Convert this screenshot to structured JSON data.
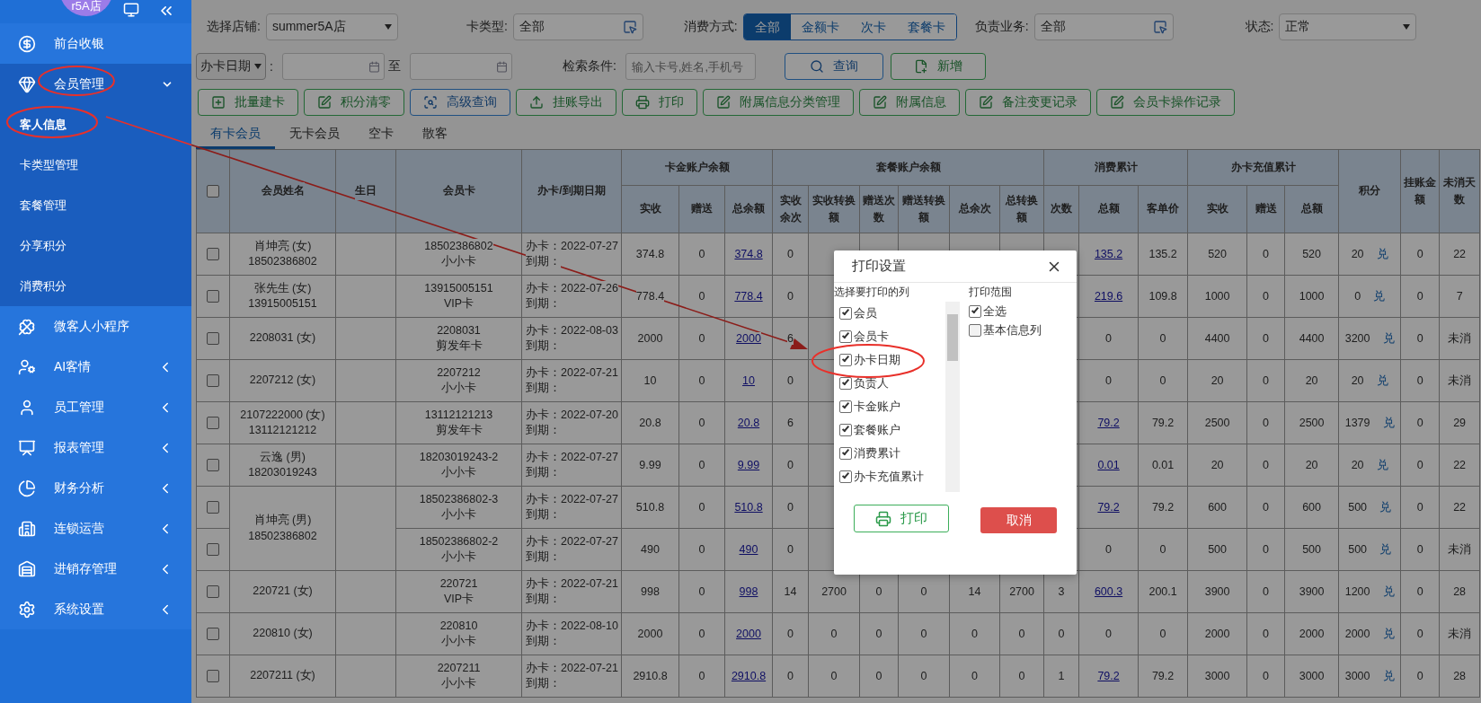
{
  "sidebar": {
    "store_badge": "r5A店",
    "items": [
      {
        "label": "前台收银"
      },
      {
        "label": "会员管理",
        "expanded": true,
        "children": [
          {
            "label": "客人信息",
            "selected": true
          },
          {
            "label": "卡类型管理",
            "selected": false
          },
          {
            "label": "套餐管理",
            "selected": false
          },
          {
            "label": "分享积分",
            "selected": false
          },
          {
            "label": "消费积分",
            "selected": false
          }
        ]
      },
      {
        "label": "微客人小程序"
      },
      {
        "label": "AI客情",
        "expanded": false
      },
      {
        "label": "员工管理",
        "expanded": false
      },
      {
        "label": "报表管理",
        "expanded": false
      },
      {
        "label": "财务分析",
        "expanded": false
      },
      {
        "label": "连锁运营",
        "expanded": false
      },
      {
        "label": "进销存管理",
        "expanded": false
      },
      {
        "label": "系统设置",
        "expanded": false
      }
    ]
  },
  "filters": {
    "store": {
      "label": "选择店铺:",
      "value": "summer5A店"
    },
    "card_type": {
      "label": "卡类型:",
      "value": "全部"
    },
    "consume_mode": {
      "label": "消费方式:",
      "options": [
        {
          "label": "全部",
          "selected": true
        },
        {
          "label": "金额卡",
          "selected": false
        },
        {
          "label": "次卡",
          "selected": false
        },
        {
          "label": "套餐卡",
          "selected": false
        }
      ]
    },
    "staff": {
      "label": "负责业务:",
      "value": "全部"
    },
    "status": {
      "label": "状态:",
      "value": "正常"
    },
    "date_type": "办卡日期",
    "date_separator": ":",
    "date_to": "至",
    "search": {
      "label": "检索条件:",
      "placeholder": "输入卡号,姓名,手机号"
    },
    "query_button": "查询",
    "add_button": "新增"
  },
  "actions": [
    {
      "label": "批量建卡",
      "kind": "success"
    },
    {
      "label": "积分清零",
      "kind": "success"
    },
    {
      "label": "高级查询",
      "kind": "info"
    },
    {
      "label": "挂账导出",
      "kind": "success"
    },
    {
      "label": "打印",
      "kind": "success"
    },
    {
      "label": "附属信息分类管理",
      "kind": "success"
    },
    {
      "label": "附属信息",
      "kind": "success"
    },
    {
      "label": "备注变更记录",
      "kind": "success"
    },
    {
      "label": "会员卡操作记录",
      "kind": "success"
    }
  ],
  "tabs": [
    {
      "label": "有卡会员",
      "selected": true
    },
    {
      "label": "无卡会员",
      "selected": false
    },
    {
      "label": "空卡",
      "selected": false
    },
    {
      "label": "散客",
      "selected": false
    }
  ],
  "table": {
    "select_all_checked": false,
    "columns": [
      {
        "label": "会员姓名"
      },
      {
        "label": "生日"
      },
      {
        "label": "会员卡"
      },
      {
        "label": "办卡/到期日期"
      },
      {
        "label": "卡金账户余额",
        "children": [
          "实收",
          "赠送",
          "总余额"
        ]
      },
      {
        "label": "套餐账户余额",
        "children": [
          "实收余次",
          "实收转换额",
          "赠送次数",
          "赠送转换额",
          "总余次",
          "总转换额"
        ]
      },
      {
        "label": "消费累计",
        "children": [
          "次数",
          "总额",
          "客单价"
        ]
      },
      {
        "label": "办卡充值累计",
        "children": [
          "实收",
          "赠送",
          "总额"
        ]
      },
      {
        "label": "积分"
      },
      {
        "label": "挂账金额"
      },
      {
        "label": "未消天数"
      }
    ],
    "members": [
      {
        "name": "肖坤亮 (女)",
        "phone": "18502386802",
        "cards": [
          {
            "number": "18502386802",
            "type": "小小卡",
            "open": "办卡：2022-07-27",
            "expire": "到期：",
            "checked": false,
            "cells": [
              "374.8",
              "0",
              {
                "link": "374.8"
              },
              "0",
              null,
              null,
              null,
              null,
              null,
              null,
              {
                "link": "135.2"
              },
              "135.2",
              "520",
              "0",
              "520",
              {
                "text": "20",
                "action": "兑"
              },
              "0",
              "22"
            ]
          }
        ]
      },
      {
        "name": "张先生 (女)",
        "phone": "13915005151",
        "cards": [
          {
            "number": "13915005151",
            "type": "VIP卡",
            "open": "办卡：2022-07-26",
            "expire": "到期：",
            "checked": false,
            "cells": [
              "778.4",
              "0",
              {
                "link": "778.4"
              },
              "0",
              null,
              null,
              null,
              null,
              null,
              null,
              {
                "link": "219.6"
              },
              "109.8",
              "1000",
              "0",
              "1000",
              {
                "text": "0",
                "action": "兑"
              },
              "0",
              "7"
            ]
          }
        ]
      },
      {
        "name": "2208031 (女)",
        "cards": [
          {
            "number": "2208031",
            "type": "剪发年卡",
            "open": "办卡：2022-08-03",
            "expire": "到期：",
            "checked": false,
            "cells": [
              "2000",
              "0",
              {
                "link": "2000"
              },
              "6",
              null,
              null,
              null,
              null,
              null,
              null,
              "0",
              "0",
              "4400",
              "0",
              "4400",
              {
                "text": "3200",
                "action": "兑"
              },
              "0",
              "未消"
            ]
          }
        ]
      },
      {
        "name": "2207212 (女)",
        "cards": [
          {
            "number": "2207212",
            "type": "小小卡",
            "open": "办卡：2022-07-21",
            "expire": "到期：",
            "checked": false,
            "cells": [
              "10",
              "0",
              {
                "link": "10"
              },
              "0",
              null,
              null,
              null,
              null,
              null,
              null,
              "0",
              "0",
              "20",
              "0",
              "20",
              {
                "text": "20",
                "action": "兑"
              },
              "0",
              "未消"
            ]
          }
        ]
      },
      {
        "name": "2107222000 (女)",
        "phone": "13112121212",
        "cards": [
          {
            "number": "13112121213",
            "type": "剪发年卡",
            "open": "办卡：2022-07-20",
            "expire": "到期：",
            "checked": false,
            "cells": [
              "20.8",
              "0",
              {
                "link": "20.8"
              },
              "6",
              null,
              null,
              null,
              null,
              null,
              null,
              {
                "link": "79.2"
              },
              "79.2",
              "2500",
              "0",
              "2500",
              {
                "text": "1379",
                "action": "兑"
              },
              "0",
              "29"
            ]
          }
        ]
      },
      {
        "name": "云逸 (男)",
        "phone": "18203019243",
        "cards": [
          {
            "number": "18203019243-2",
            "type": "小小卡",
            "open": "办卡：2022-07-27",
            "expire": "到期：",
            "checked": false,
            "cells": [
              "9.99",
              "0",
              {
                "link": "9.99"
              },
              "0",
              null,
              null,
              null,
              null,
              null,
              null,
              {
                "link": "0.01"
              },
              "0.01",
              "20",
              "0",
              "20",
              {
                "text": "20",
                "action": "兑"
              },
              "0",
              "22"
            ]
          }
        ]
      },
      {
        "name": "肖坤亮 (男)",
        "phone": "18502386802",
        "cards": [
          {
            "number": "18502386802-3",
            "type": "小小卡",
            "open": "办卡：2022-07-27",
            "expire": "到期：",
            "checked": false,
            "cells": [
              "510.8",
              "0",
              {
                "link": "510.8"
              },
              "0",
              null,
              null,
              null,
              null,
              null,
              null,
              {
                "link": "79.2"
              },
              "79.2",
              "600",
              "0",
              "600",
              {
                "text": "500",
                "action": "兑"
              },
              "0",
              "22"
            ]
          },
          {
            "number": "18502386802-2",
            "type": "小小卡",
            "open": "办卡：2022-07-27",
            "expire": "到期：",
            "checked": false,
            "cells": [
              "490",
              "0",
              {
                "link": "490"
              },
              "0",
              null,
              null,
              null,
              null,
              null,
              null,
              "0",
              "0",
              "500",
              "0",
              "500",
              {
                "text": "500",
                "action": "兑"
              },
              "0",
              "未消"
            ]
          }
        ]
      },
      {
        "name": "220721 (女)",
        "cards": [
          {
            "number": "220721",
            "type": "VIP卡",
            "open": "办卡：2022-07-21",
            "expire": "到期：",
            "checked": false,
            "cells": [
              "998",
              "0",
              {
                "link": "998"
              },
              "14",
              "2700",
              "0",
              "0",
              "14",
              "2700",
              "3",
              {
                "link": "600.3"
              },
              "200.1",
              "3900",
              "0",
              "3900",
              {
                "text": "1200",
                "action": "兑"
              },
              "0",
              "28"
            ]
          }
        ]
      },
      {
        "name": "220810 (女)",
        "cards": [
          {
            "number": "220810",
            "type": "小小卡",
            "open": "办卡：2022-08-10",
            "expire": "到期：",
            "checked": false,
            "cells": [
              "2000",
              "0",
              {
                "link": "2000"
              },
              "0",
              "0",
              "0",
              "0",
              "0",
              "0",
              "0",
              "0",
              "0",
              "2000",
              "0",
              "2000",
              {
                "text": "2000",
                "action": "兑"
              },
              "0",
              "未消"
            ]
          }
        ]
      },
      {
        "name": "2207211 (女)",
        "cards": [
          {
            "number": "2207211",
            "type": "小小卡",
            "open": "办卡：2022-07-21",
            "expire": "到期：",
            "checked": false,
            "cells": [
              "2910.8",
              "0",
              {
                "link": "2910.8"
              },
              "0",
              "0",
              "0",
              "0",
              "0",
              "0",
              "1",
              {
                "link": "79.2"
              },
              "79.2",
              "3000",
              "0",
              "3000",
              {
                "text": "3000",
                "action": "兑"
              },
              "0",
              "28"
            ]
          }
        ]
      }
    ]
  },
  "print_dialog": {
    "title": "打印设置",
    "columns_label": "选择要打印的列",
    "columns": [
      {
        "label": "会员",
        "checked": true
      },
      {
        "label": "会员卡",
        "checked": true
      },
      {
        "label": "办卡日期",
        "checked": true
      },
      {
        "label": "负责人",
        "checked": true
      },
      {
        "label": "卡金账户",
        "checked": true
      },
      {
        "label": "套餐账户",
        "checked": true
      },
      {
        "label": "消费累计",
        "checked": true
      },
      {
        "label": "办卡充值累计",
        "checked": true
      }
    ],
    "range_label": "打印范围",
    "range": [
      {
        "label": "全选",
        "checked": true
      },
      {
        "label": "基本信息列",
        "checked": false
      }
    ],
    "print_button": "打印",
    "cancel_button": "取消"
  }
}
